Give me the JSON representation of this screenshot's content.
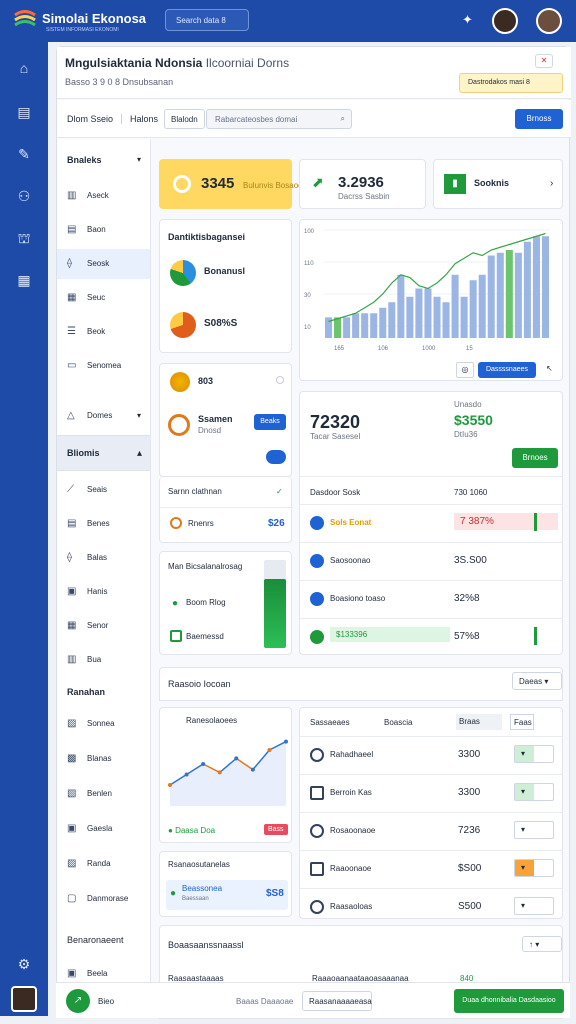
{
  "app": {
    "brand": "Simolai Ekonosa",
    "brand_sub": "SISTEM INFORMASI EKONOMI",
    "search_placeholder": "Search data 8"
  },
  "header": {
    "title": "Mngulsiaktania Ndonsia",
    "title_secondary": "Ilcoorniai Dorns",
    "subtitle": "Basso 3 9 0 8 Dnsubsanan",
    "alert": "Dastrodakos masi 8"
  },
  "toolbar": {
    "label_main": "Dlom Sseio",
    "label_2": "Halons",
    "btn_1": "Blalodn",
    "search_placeholder": "Rabarcateosbes domai",
    "primary": "Brnoss"
  },
  "sidebar": {
    "head_top": "Bnaleks",
    "items_top": [
      {
        "label": "Aseck",
        "icon": "book-icon"
      },
      {
        "label": "Baon",
        "icon": "doc-icon"
      },
      {
        "label": "Seosk",
        "icon": "chart-icon"
      },
      {
        "label": "Seuc",
        "icon": "grid-icon"
      },
      {
        "label": "Beok",
        "icon": "list-icon"
      },
      {
        "label": "Senomea",
        "icon": "folder-icon"
      }
    ],
    "item_domes": "Domes",
    "section_label": "Bliomis",
    "items_mid": [
      {
        "label": "Seais",
        "icon": "trend-icon"
      },
      {
        "label": "Benes",
        "icon": "doc-icon"
      },
      {
        "label": "Balas",
        "icon": "chart-icon"
      },
      {
        "label": "Hanis",
        "icon": "calendar-icon"
      },
      {
        "label": "Senor",
        "icon": "grid-icon"
      },
      {
        "label": "Bua",
        "icon": "table-icon"
      }
    ],
    "head_mid2": "Ranahan",
    "items_bottom": [
      {
        "label": "Sonnea",
        "icon": "image-icon"
      },
      {
        "label": "Blanas",
        "icon": "card-icon"
      },
      {
        "label": "Benlen",
        "icon": "wallet-icon"
      },
      {
        "label": "Gaesla",
        "icon": "calendar-icon"
      },
      {
        "label": "Randa",
        "icon": "photo-icon"
      },
      {
        "label": "Danmorase",
        "icon": "window-icon"
      }
    ],
    "head_bottom": "Benaronaeent",
    "item_last": "Beela"
  },
  "kpis": [
    {
      "value": "3345",
      "sub": "Bulunvis Bosaoe",
      "accent": "#ffd862"
    },
    {
      "value": "3.2936",
      "sub": "Dacrss Sasbin",
      "accent": "#1e9a3c"
    },
    {
      "value": "Sooknis",
      "sub": "",
      "accent": "#1e9a3c"
    }
  ],
  "left_cards": {
    "card_a_title": "Dantiktisbagansei",
    "card_a_row1": "Bonanusl",
    "card_a_row2": "S08%S",
    "card_b_value": "803",
    "card_b_title": "Ssamen",
    "card_b_sub": "Dnosd",
    "card_b_btn": "Beaks",
    "list_head": "Sarnn clathnan",
    "list_row": "Rnenrs",
    "list_row_value": "$26",
    "card_c_title": "Man Bicsalanalrosag",
    "card_c_row1": "Boom Rlog",
    "card_c_row2": "Baemessd",
    "progress_fraction": 0.78
  },
  "chart_data": {
    "type": "bar",
    "categories": [
      "1",
      "2",
      "3",
      "4",
      "5",
      "6",
      "7",
      "8",
      "9",
      "10",
      "11",
      "12",
      "13",
      "14",
      "15",
      "16",
      "17",
      "18",
      "19",
      "20",
      "21",
      "22",
      "23",
      "24",
      "25"
    ],
    "series": [
      {
        "values": [
          15,
          15,
          15,
          18,
          18,
          18,
          22,
          26,
          46,
          30,
          36,
          36,
          30,
          26,
          46,
          30,
          42,
          46,
          60,
          62,
          64,
          62,
          70,
          74,
          74
        ]
      }
    ],
    "line": [
      12,
      14,
      16,
      18,
      22,
      26,
      32,
      40,
      46,
      44,
      38,
      36,
      40,
      46,
      54,
      58,
      62,
      60,
      64,
      66,
      68,
      70,
      72,
      74,
      76
    ],
    "yticks": [
      "100",
      "110",
      "30",
      "10"
    ],
    "xticks": [
      "165",
      "106",
      "1000",
      "15"
    ],
    "ylim": [
      0,
      80
    ],
    "footer_btn": "Dassssnaees"
  },
  "summary": {
    "value_left": "72320",
    "value_left_sub": "Tacar Sasesel",
    "value_right": "$3550",
    "value_right_sub": "DtIu36",
    "label_right_top": "Unasdo",
    "green_btn": "Brnoes",
    "head_left": "Dasdoor Sosk",
    "head_right": "730 1060",
    "rows": [
      {
        "label": "Sols Eonat",
        "value": "7 387%",
        "status": "red"
      },
      {
        "label": "Saosoonao",
        "value": "3S.S00",
        "status": "none"
      },
      {
        "label": "Boasiono toaso",
        "value": "32%8",
        "status": "none"
      },
      {
        "label": "$133396",
        "value": "57%8",
        "status": "green"
      }
    ]
  },
  "lower": {
    "section_title": "Raasoio Iocoan",
    "filter": "Daeas",
    "mini_chart_title": "Ranesolaoees",
    "mini_chart_badge_green": "Daasa Doa",
    "mini_chart_badge_red": "Bass",
    "mini_chart_data": [
      30,
      45,
      60,
      48,
      68,
      52,
      80,
      92
    ],
    "card2_title": "Rsanaosutanelas",
    "card2_row": "Beassonea",
    "card2_row_sub": "Baessaan",
    "card2_value": "$S8",
    "table_head": [
      "Sassaeaes",
      "Boascia",
      "Braas",
      "Faas"
    ],
    "table_rows": [
      {
        "name": "Rahadhaeel",
        "value": "3300",
        "tag": "green"
      },
      {
        "name": "Berroin Kas",
        "value": "3300",
        "tag": "green"
      },
      {
        "name": "Rosaoonaoe",
        "value": "7236",
        "tag": "none"
      },
      {
        "name": "Raaoonaoe",
        "value": "$S00",
        "tag": "orange"
      },
      {
        "name": "Raasaoloas",
        "value": "S500",
        "tag": "none"
      }
    ],
    "bottom_section": "Boaasaanssnaassl",
    "bottom_row_left": "Raasaastaaaas",
    "bottom_row_mid": "Raaaoaanaataaoasaaanaa",
    "bottom_row_right": "840"
  },
  "bottombar": {
    "text": "Bieo",
    "mid": "Baaas Daaaoae",
    "search": "Raasanaaaaeasa",
    "green_btn": "Duaa dhonnibalia Dasdaasioo"
  }
}
